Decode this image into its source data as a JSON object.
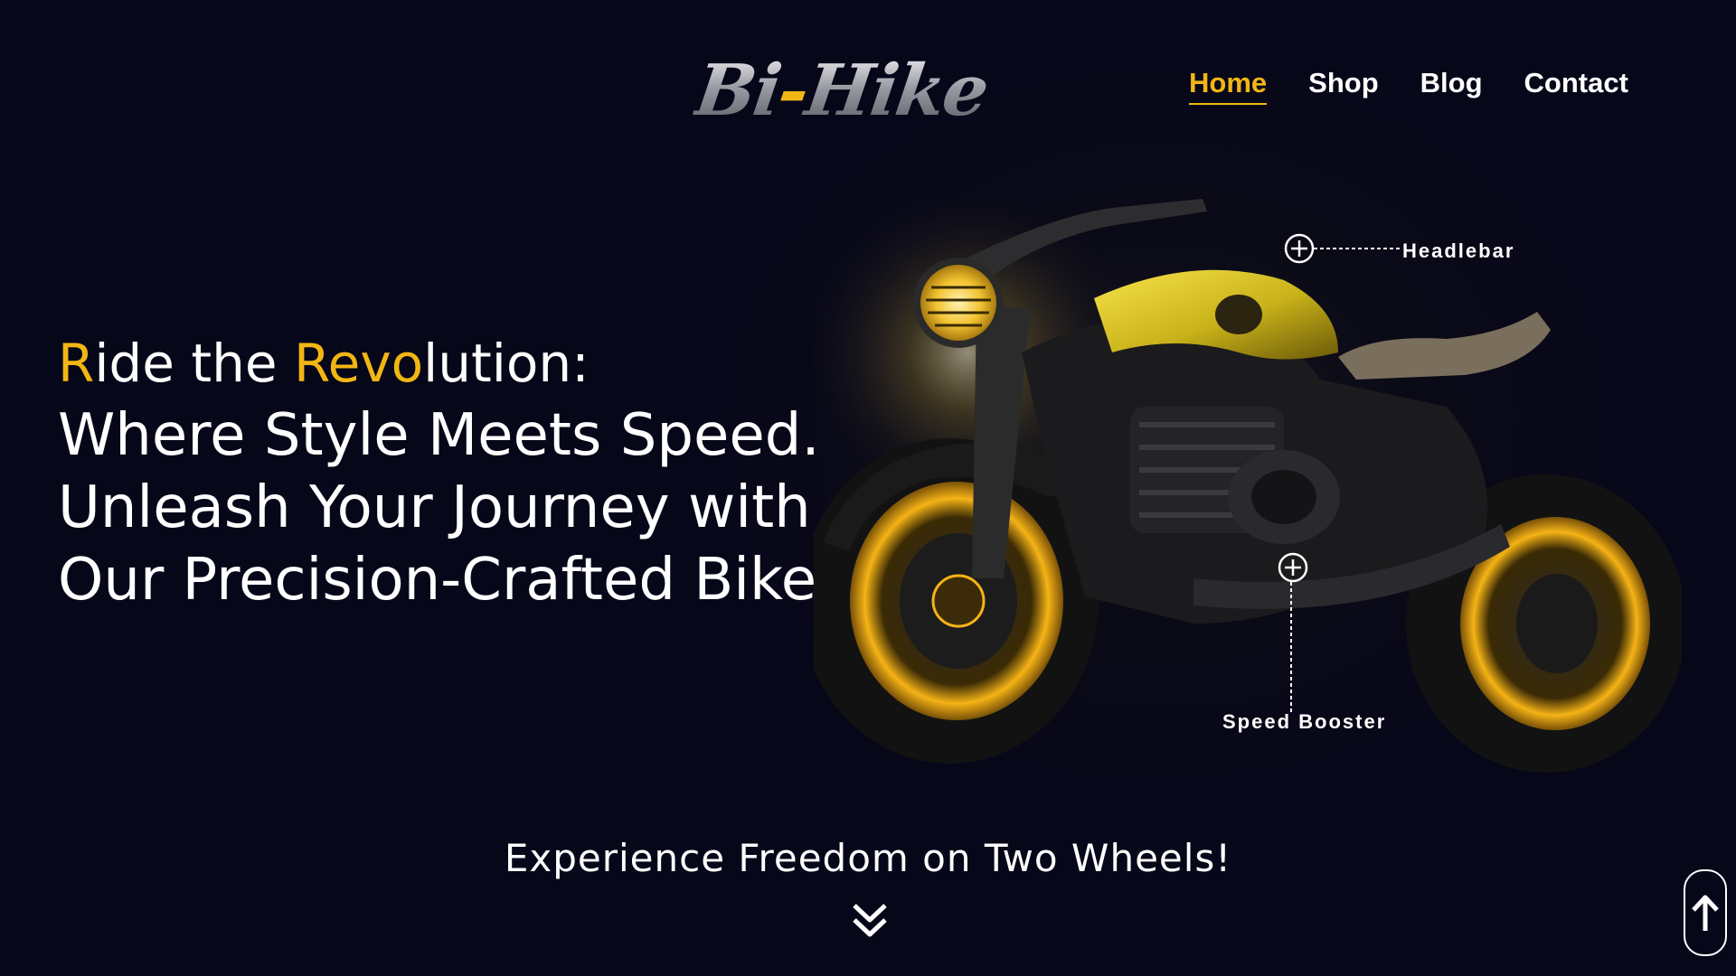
{
  "brand": {
    "logo_text_a": "Bi",
    "logo_dash": "-",
    "logo_text_b": "Hike"
  },
  "nav": {
    "items": [
      {
        "label": "Home",
        "active": true
      },
      {
        "label": "Shop",
        "active": false
      },
      {
        "label": "Blog",
        "active": false
      },
      {
        "label": "Contact",
        "active": false
      }
    ]
  },
  "hero": {
    "line1_parts": [
      "R",
      "ide the ",
      "Revo",
      "lution:"
    ],
    "line2": "Where Style Meets Speed.",
    "line3": "Unleash Your Journey with",
    "line4": "Our Precision-Crafted Bikes"
  },
  "hotspots": {
    "headlebar": "Headlebar",
    "speed_booster": "Speed Booster"
  },
  "tagline": "Experience Freedom on Two Wheels!",
  "colors": {
    "accent": "#f2b614",
    "background": "#07071a",
    "text": "#ffffff"
  },
  "icons": {
    "scroll_down": "double-chevron-down-icon",
    "back_to_top": "arrow-up-icon",
    "hotspot": "plus-circle-icon"
  }
}
